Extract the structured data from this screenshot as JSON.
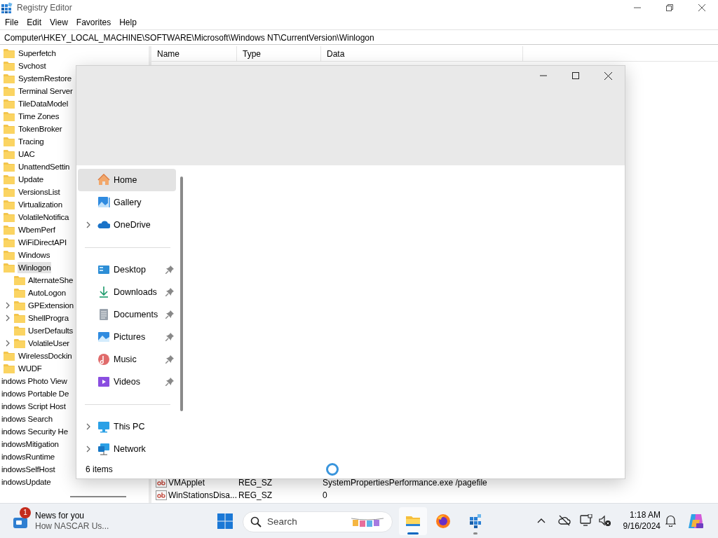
{
  "regedit": {
    "title": "Registry Editor",
    "menu": [
      "File",
      "Edit",
      "View",
      "Favorites",
      "Help"
    ],
    "address": "Computer\\HKEY_LOCAL_MACHINE\\SOFTWARE\\Microsoft\\Windows NT\\CurrentVersion\\Winlogon",
    "tree": [
      {
        "label": "Superfetch",
        "selected": false
      },
      {
        "label": "Svchost",
        "selected": false
      },
      {
        "label": "SystemRestore",
        "selected": false
      },
      {
        "label": "Terminal Server",
        "selected": false
      },
      {
        "label": "TileDataModel",
        "selected": false
      },
      {
        "label": "Time Zones",
        "selected": false
      },
      {
        "label": "TokenBroker",
        "selected": false
      },
      {
        "label": "Tracing",
        "selected": false
      },
      {
        "label": "UAC",
        "selected": false
      },
      {
        "label": "UnattendSettin",
        "selected": false
      },
      {
        "label": "Update",
        "selected": false
      },
      {
        "label": "VersionsList",
        "selected": false
      },
      {
        "label": "Virtualization",
        "selected": false
      },
      {
        "label": "VolatileNotifica",
        "selected": false
      },
      {
        "label": "WbemPerf",
        "selected": false
      },
      {
        "label": "WiFiDirectAPI",
        "selected": false
      },
      {
        "label": "Windows",
        "selected": false
      },
      {
        "label": "Winlogon",
        "selected": true,
        "children": [
          {
            "label": "AlternateShe",
            "expandable": false
          },
          {
            "label": "AutoLogon",
            "expandable": false
          },
          {
            "label": "GPExtension",
            "expandable": true
          },
          {
            "label": "ShellProgra",
            "expandable": true
          },
          {
            "label": "UserDefaults",
            "expandable": false
          },
          {
            "label": "VolatileUser",
            "expandable": true
          }
        ]
      },
      {
        "label": "WirelessDockin",
        "selected": false
      },
      {
        "label": "WUDF",
        "selected": false
      }
    ],
    "tree_outer": [
      "indows Photo View",
      "indows Portable De",
      "indows Script Host",
      "indows Search",
      "indows Security He",
      "indowsMitigation",
      "indowsRuntime",
      "indowsSelfHost",
      "indowsUpdate"
    ],
    "columns": [
      "Name",
      "Type",
      "Data"
    ],
    "rows": [
      {
        "name": "VMApplet",
        "type": "REG_SZ",
        "data": "SystemPropertiesPerformance.exe /pagefile"
      },
      {
        "name": "WinStationsDisa...",
        "type": "REG_SZ",
        "data": "0"
      }
    ]
  },
  "explorer": {
    "nav_groups": [
      {
        "items": [
          {
            "label": "Home",
            "kind": "home",
            "selected": true,
            "expandable": false,
            "pinned": false
          },
          {
            "label": "Gallery",
            "kind": "gallery",
            "selected": false,
            "expandable": false,
            "pinned": false
          },
          {
            "label": "OneDrive",
            "kind": "cloud",
            "selected": false,
            "expandable": true,
            "pinned": false
          }
        ]
      },
      {
        "items": [
          {
            "label": "Desktop",
            "kind": "desktop",
            "selected": false,
            "expandable": false,
            "pinned": true
          },
          {
            "label": "Downloads",
            "kind": "download",
            "selected": false,
            "expandable": false,
            "pinned": true
          },
          {
            "label": "Documents",
            "kind": "document",
            "selected": false,
            "expandable": false,
            "pinned": true
          },
          {
            "label": "Pictures",
            "kind": "pictures",
            "selected": false,
            "expandable": false,
            "pinned": true
          },
          {
            "label": "Music",
            "kind": "music",
            "selected": false,
            "expandable": false,
            "pinned": true
          },
          {
            "label": "Videos",
            "kind": "videos",
            "selected": false,
            "expandable": false,
            "pinned": true
          }
        ]
      },
      {
        "items": [
          {
            "label": "This PC",
            "kind": "pc",
            "selected": false,
            "expandable": true,
            "pinned": false
          },
          {
            "label": "Network",
            "kind": "network",
            "selected": false,
            "expandable": true,
            "pinned": false
          }
        ]
      }
    ],
    "status": "6 items"
  },
  "taskbar": {
    "news": {
      "badge": "1",
      "title": "News for you",
      "subtitle": "How NASCAR Us..."
    },
    "search": {
      "placeholder": "Search"
    },
    "apps": [
      {
        "kind": "explorer",
        "active": true,
        "running": true
      },
      {
        "kind": "firefox",
        "active": false,
        "running": false
      },
      {
        "kind": "regedit",
        "active": false,
        "running": true
      }
    ],
    "clock": {
      "time": "1:18 AM",
      "date": "9/16/2024"
    }
  }
}
